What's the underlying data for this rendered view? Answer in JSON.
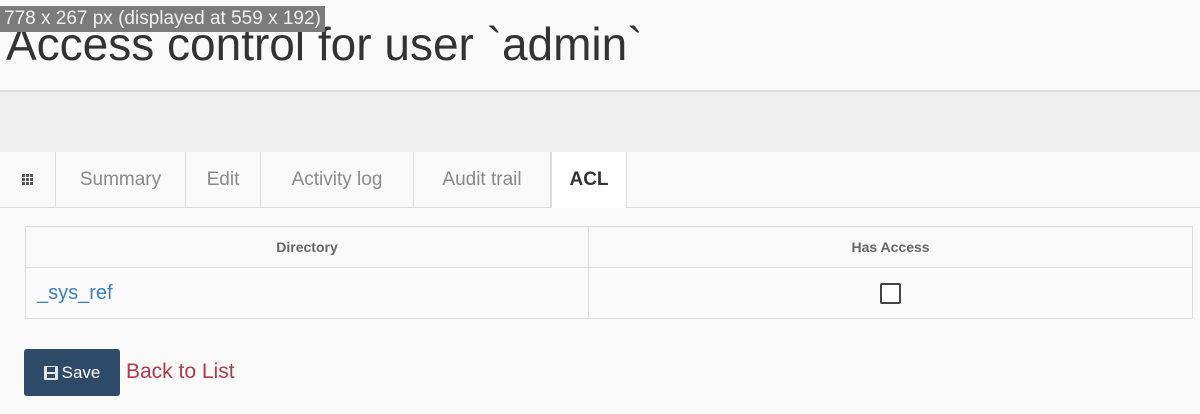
{
  "overlay": {
    "dimensions_label": "778 x 267 px (displayed at 559 x 192)"
  },
  "header": {
    "title": "Access control for user `admin`"
  },
  "tabs": [
    {
      "label": "Summary",
      "active": false
    },
    {
      "label": "Edit",
      "active": false
    },
    {
      "label": "Activity log",
      "active": false
    },
    {
      "label": "Audit trail",
      "active": false
    },
    {
      "label": "ACL",
      "active": true
    }
  ],
  "tabs_icon": "grid-icon",
  "table": {
    "columns": [
      "Directory",
      "Has Access"
    ],
    "rows": [
      {
        "directory": "_sys_ref",
        "has_access": false
      }
    ]
  },
  "actions": {
    "save_label": "Save",
    "save_icon": "floppy-icon",
    "back_label": "Back to List"
  },
  "colors": {
    "primary_button": "#2f4a68",
    "link": "#3a7fc4",
    "back_link": "#b03a4a"
  }
}
